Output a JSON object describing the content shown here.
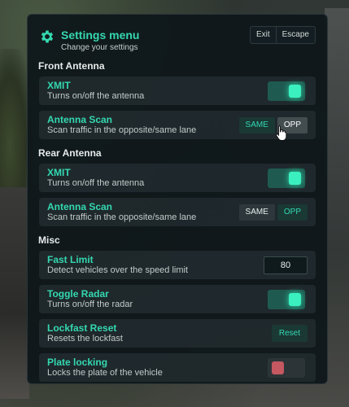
{
  "header": {
    "title": "Settings menu",
    "subtitle": "Change your settings",
    "keys": [
      "Exit",
      "Escape"
    ]
  },
  "sections": {
    "front": {
      "title": "Front Antenna",
      "xmit": {
        "title": "XMIT",
        "desc": "Turns on/off the antenna",
        "state": "on"
      },
      "scan": {
        "title": "Antenna Scan",
        "desc": "Scan traffic in the opposite/same lane",
        "same": "SAME",
        "opp": "OPP",
        "selected": "SAME"
      }
    },
    "rear": {
      "title": "Rear Antenna",
      "xmit": {
        "title": "XMIT",
        "desc": "Turns on/off the antenna",
        "state": "on"
      },
      "scan": {
        "title": "Antenna Scan",
        "desc": "Scan traffic in the opposite/same lane",
        "same": "SAME",
        "opp": "OPP",
        "selected": "OPP"
      }
    },
    "misc": {
      "title": "Misc",
      "fast_limit": {
        "title": "Fast Limit",
        "desc": "Detect vehicles over the speed limit",
        "value": "80"
      },
      "toggle_radar": {
        "title": "Toggle Radar",
        "desc": "Turns on/off the radar",
        "state": "on"
      },
      "lockfast_reset": {
        "title": "Lockfast Reset",
        "desc": "Resets the lockfast",
        "button": "Reset"
      },
      "plate_locking": {
        "title": "Plate locking",
        "desc": "Locks the plate of the vehicle",
        "state": "off"
      }
    }
  },
  "colors": {
    "accent": "#34d8b0",
    "toggle_on_knob": "#3bf0bf",
    "toggle_off_knob": "#c55860",
    "panel_bg": "#0e161a"
  },
  "icons": {
    "title_icon": "gear-icon",
    "cursor": "pointer-hand-icon"
  }
}
